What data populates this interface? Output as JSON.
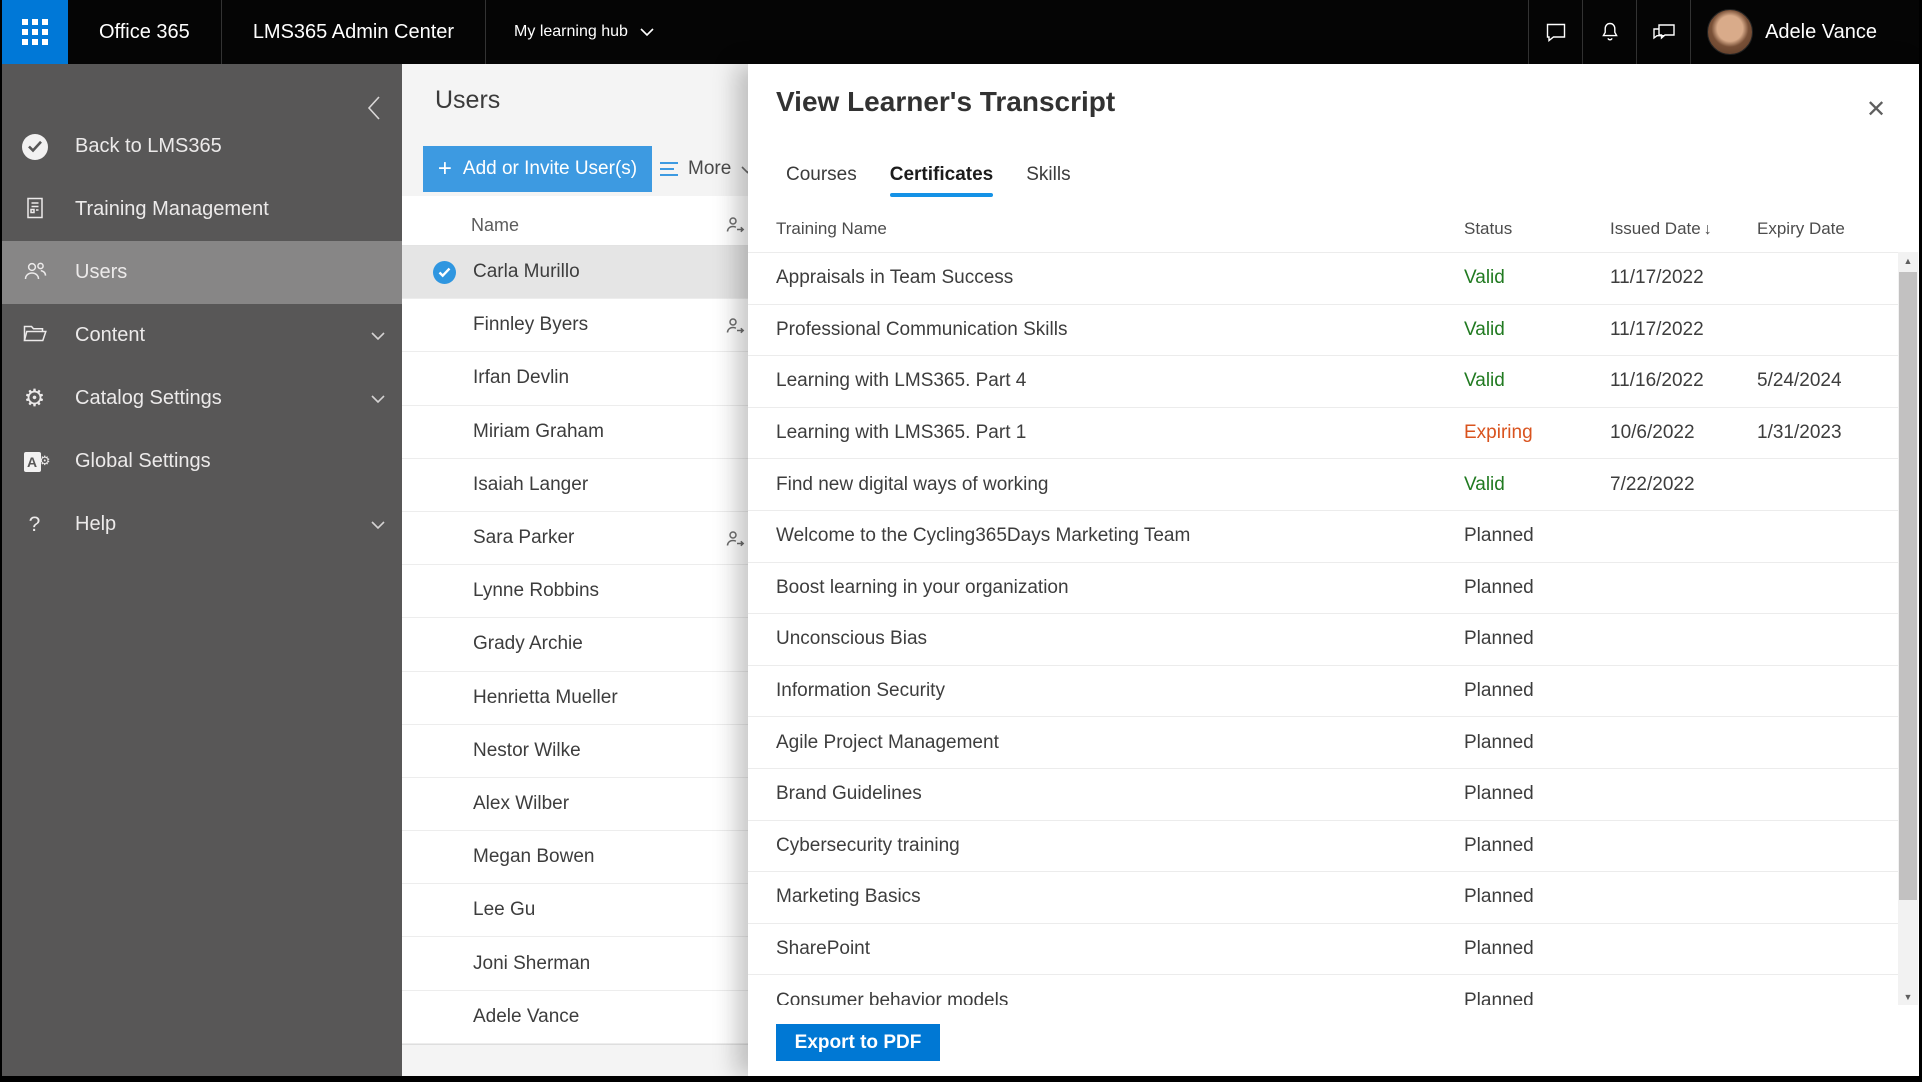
{
  "topbar": {
    "brand": "Office 365",
    "app_title": "LMS365 Admin Center",
    "hub_menu": "My learning hub",
    "user_name": "Adele Vance"
  },
  "sidebar": {
    "items": [
      {
        "label": "Back to LMS365",
        "icon": "lms365",
        "state": "",
        "expandable": false
      },
      {
        "label": "Training Management",
        "icon": "doc",
        "state": "",
        "expandable": false
      },
      {
        "label": "Users",
        "icon": "users",
        "state": "selected",
        "expandable": false
      },
      {
        "label": "Content",
        "icon": "folder",
        "state": "",
        "expandable": true
      },
      {
        "label": "Catalog Settings",
        "icon": "gear",
        "state": "",
        "expandable": true
      },
      {
        "label": "Global Settings",
        "icon": "global",
        "state": "",
        "expandable": false
      },
      {
        "label": "Help",
        "icon": "help",
        "state": "",
        "expandable": true
      }
    ]
  },
  "users_panel": {
    "title": "Users",
    "add_button": "Add or Invite User(s)",
    "more_button": "More",
    "name_header": "Name",
    "users": [
      {
        "name": "Carla Murillo",
        "state": "selected",
        "selected": true,
        "external": false
      },
      {
        "name": "Finnley Byers",
        "state": "",
        "selected": false,
        "external": true
      },
      {
        "name": "Irfan Devlin",
        "state": "",
        "selected": false,
        "external": false
      },
      {
        "name": "Miriam Graham",
        "state": "",
        "selected": false,
        "external": false
      },
      {
        "name": "Isaiah Langer",
        "state": "",
        "selected": false,
        "external": false
      },
      {
        "name": "Sara Parker",
        "state": "",
        "selected": false,
        "external": true
      },
      {
        "name": "Lynne Robbins",
        "state": "",
        "selected": false,
        "external": false
      },
      {
        "name": "Grady Archie",
        "state": "",
        "selected": false,
        "external": false
      },
      {
        "name": "Henrietta Mueller",
        "state": "",
        "selected": false,
        "external": false
      },
      {
        "name": "Nestor Wilke",
        "state": "",
        "selected": false,
        "external": false
      },
      {
        "name": "Alex Wilber",
        "state": "",
        "selected": false,
        "external": false
      },
      {
        "name": "Megan Bowen",
        "state": "",
        "selected": false,
        "external": false
      },
      {
        "name": "Lee Gu",
        "state": "",
        "selected": false,
        "external": false
      },
      {
        "name": "Joni Sherman",
        "state": "",
        "selected": false,
        "external": false
      },
      {
        "name": "Adele Vance",
        "state": "",
        "selected": false,
        "external": false
      }
    ]
  },
  "transcript_panel": {
    "title": "View Learner's Transcript",
    "tabs": [
      {
        "label": "Courses",
        "state": ""
      },
      {
        "label": "Certificates",
        "state": "active"
      },
      {
        "label": "Skills",
        "state": ""
      }
    ],
    "columns": {
      "training": "Training Name",
      "status": "Status",
      "issued": "Issued Date",
      "expiry": "Expiry Date"
    },
    "sorted_by": "Issued Date descending",
    "rows": [
      {
        "training": "Appraisals in Team Success",
        "status": "Valid",
        "issued": "11/17/2022",
        "expiry": ""
      },
      {
        "training": "Professional Communication Skills",
        "status": "Valid",
        "issued": "11/17/2022",
        "expiry": ""
      },
      {
        "training": "Learning with LMS365. Part 4",
        "status": "Valid",
        "issued": "11/16/2022",
        "expiry": "5/24/2024"
      },
      {
        "training": "Learning with LMS365. Part 1",
        "status": "Expiring",
        "issued": "10/6/2022",
        "expiry": "1/31/2023"
      },
      {
        "training": "Find new digital ways of working",
        "status": "Valid",
        "issued": "7/22/2022",
        "expiry": ""
      },
      {
        "training": "Welcome to the Cycling365Days Marketing Team",
        "status": "Planned",
        "issued": "",
        "expiry": ""
      },
      {
        "training": "Boost learning in your organization",
        "status": "Planned",
        "issued": "",
        "expiry": ""
      },
      {
        "training": "Unconscious Bias",
        "status": "Planned",
        "issued": "",
        "expiry": ""
      },
      {
        "training": "Information Security",
        "status": "Planned",
        "issued": "",
        "expiry": ""
      },
      {
        "training": "Agile Project Management",
        "status": "Planned",
        "issued": "",
        "expiry": ""
      },
      {
        "training": "Brand Guidelines",
        "status": "Planned",
        "issued": "",
        "expiry": ""
      },
      {
        "training": "Cybersecurity training",
        "status": "Planned",
        "issued": "",
        "expiry": ""
      },
      {
        "training": "Marketing Basics",
        "status": "Planned",
        "issued": "",
        "expiry": ""
      },
      {
        "training": "SharePoint",
        "status": "Planned",
        "issued": "",
        "expiry": ""
      },
      {
        "training": "Consumer behavior models",
        "status": "Planned",
        "issued": "",
        "expiry": ""
      }
    ],
    "export_button": "Export to PDF"
  },
  "icons": {
    "plus": "+",
    "close": "✕",
    "sort_desc": "↓",
    "gear": "⚙",
    "help": "?",
    "global_letter": "A",
    "scroll_up": "▲",
    "scroll_down": "▼"
  },
  "colors": {
    "brand_blue": "#0078d7",
    "button_blue": "#3d9ae1",
    "export_blue": "#0078d4",
    "tab_underline": "#1592e6",
    "status_valid": "#217a21",
    "status_expiring": "#d9531e",
    "status_planned": "#3d3d3d",
    "sidebar_bg": "#585757",
    "sidebar_selected": "#878686"
  }
}
